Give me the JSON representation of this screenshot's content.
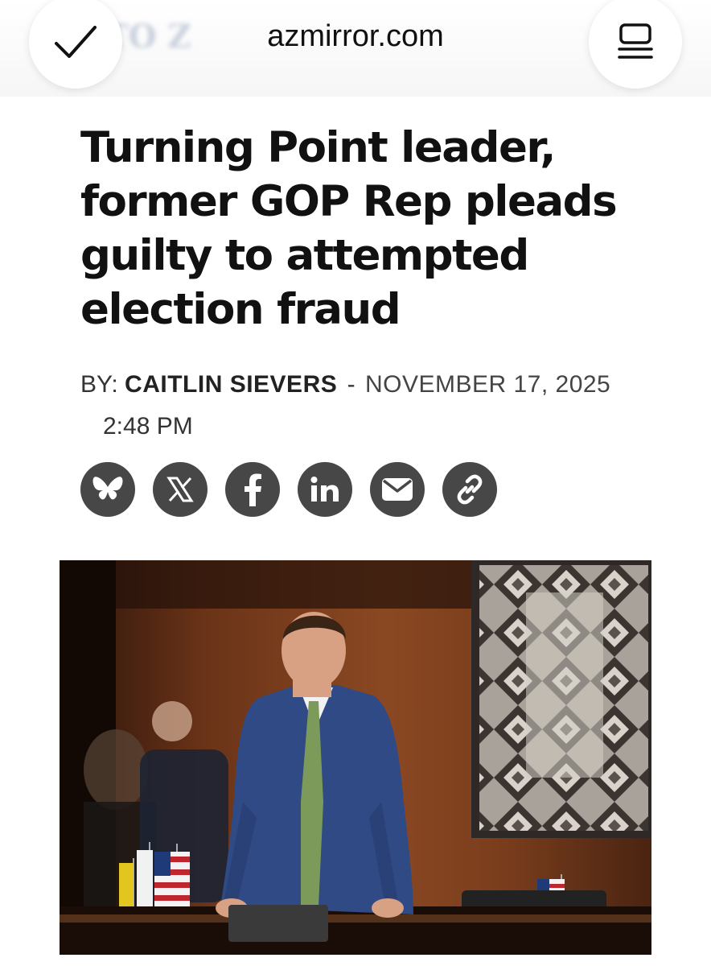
{
  "browser": {
    "domain": "azmirror.com",
    "ghost_logo": "TO Z",
    "done_icon": "checkmark-icon",
    "menu_icon": "reader-menu-icon"
  },
  "article": {
    "headline": "Turning Point leader, former GOP Rep pleads guilty to attempted election fraud",
    "by_label": "BY:",
    "author": "CAITLIN SIEVERS",
    "separator": "-",
    "date": "NOVEMBER 17, 2025",
    "time": "2:48 PM"
  },
  "share": {
    "buttons": [
      {
        "icon": "bluesky-icon"
      },
      {
        "icon": "x-icon"
      },
      {
        "icon": "facebook-icon"
      },
      {
        "icon": "linkedin-icon"
      },
      {
        "icon": "email-icon"
      },
      {
        "icon": "link-icon"
      }
    ]
  },
  "colors": {
    "share_bg": "#474747",
    "headline": "#111111"
  }
}
